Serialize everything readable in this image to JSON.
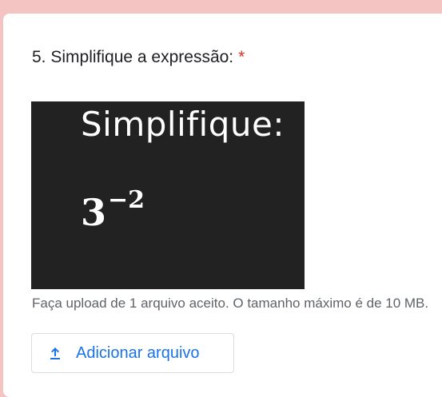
{
  "question": {
    "title": "5. Simplifique a expressão:",
    "required_marker": "*"
  },
  "question_image": {
    "heading": "Simplifique:",
    "expression_base": "3",
    "expression_exponent": "−2"
  },
  "upload": {
    "note": "Faça upload de 1 arquivo aceito. O tamanho máximo é de 10 MB.",
    "button_label": "Adicionar arquivo",
    "icon": "upload-icon"
  },
  "colors": {
    "background": "#f3c4c2",
    "accent": "#1a73e8",
    "required": "#d93025",
    "image_bg": "#222222"
  }
}
